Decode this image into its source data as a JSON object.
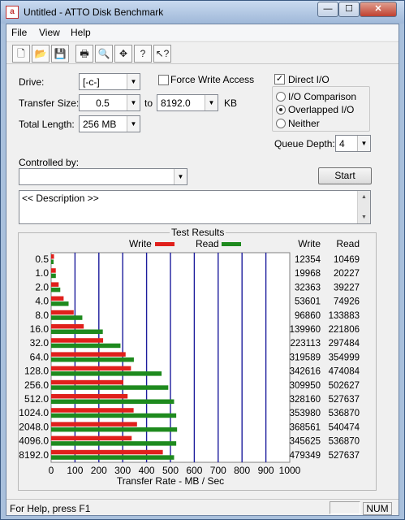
{
  "window": {
    "title": "Untitled - ATTO Disk Benchmark",
    "icon_text": "a"
  },
  "title_buttons": {
    "minimize": "—",
    "maximize": "☐",
    "close": "✕"
  },
  "menu": [
    "File",
    "View",
    "Help"
  ],
  "toolbar": [
    {
      "name": "new-icon",
      "glyph": "🗋"
    },
    {
      "name": "open-icon",
      "glyph": "📂"
    },
    {
      "name": "save-icon",
      "glyph": "💾"
    },
    {
      "name": "print-icon",
      "glyph": "🖶"
    },
    {
      "name": "print-preview-icon",
      "glyph": "🔍"
    },
    {
      "name": "move-icon",
      "glyph": "✥"
    },
    {
      "name": "help-icon",
      "glyph": "?"
    },
    {
      "name": "context-help-icon",
      "glyph": "↖?"
    }
  ],
  "settings": {
    "drive_label": "Drive:",
    "drive_value": "[-c-]",
    "transfer_size_label": "Transfer Size:",
    "transfer_from": "0.5",
    "to_label": "to",
    "transfer_to": "8192.0",
    "kb_label": "KB",
    "total_length_label": "Total Length:",
    "total_length_value": "256 MB",
    "force_write_label": "Force Write Access",
    "force_write_checked": false,
    "direct_io_label": "Direct I/O",
    "direct_io_checked": true,
    "io_comparison_label": "I/O Comparison",
    "overlapped_io_label": "Overlapped I/O",
    "neither_label": "Neither",
    "selected_mode": "Overlapped I/O",
    "queue_depth_label": "Queue Depth:",
    "queue_depth_value": "4",
    "controlled_by_label": "Controlled by:",
    "controlled_by_value": "",
    "start_label": "Start",
    "description_text": "<< Description >>"
  },
  "results": {
    "title": "Test Results",
    "write_legend": "Write",
    "read_legend": "Read",
    "write_header": "Write",
    "read_header": "Read",
    "write_color": "#e0201c",
    "read_color": "#1e8a1e",
    "grid_color": "#1c1c9c"
  },
  "chart_data": {
    "type": "bar",
    "orientation": "horizontal",
    "categories": [
      "0.5",
      "1.0",
      "2.0",
      "4.0",
      "8.0",
      "16.0",
      "32.0",
      "64.0",
      "128.0",
      "256.0",
      "512.0",
      "1024.0",
      "2048.0",
      "4096.0",
      "8192.0"
    ],
    "series": [
      {
        "name": "Write",
        "values": [
          12354,
          19968,
          32363,
          53601,
          96860,
          139960,
          223113,
          319589,
          342616,
          309950,
          328160,
          353980,
          368561,
          345625,
          479349
        ]
      },
      {
        "name": "Read",
        "values": [
          10469,
          20227,
          39227,
          74926,
          133883,
          221806,
          297484,
          354999,
          474084,
          502627,
          527637,
          536870,
          540474,
          536870,
          527637
        ]
      }
    ],
    "xlabel": "Transfer Rate - MB / Sec",
    "xlim": [
      0,
      1000
    ],
    "xticks": [
      "0",
      "100",
      "200",
      "300",
      "400",
      "500",
      "600",
      "700",
      "800",
      "900",
      "1000"
    ],
    "grid": true,
    "legend": "top-center"
  },
  "status": {
    "help_text": "For Help, press F1",
    "num": "NUM"
  }
}
